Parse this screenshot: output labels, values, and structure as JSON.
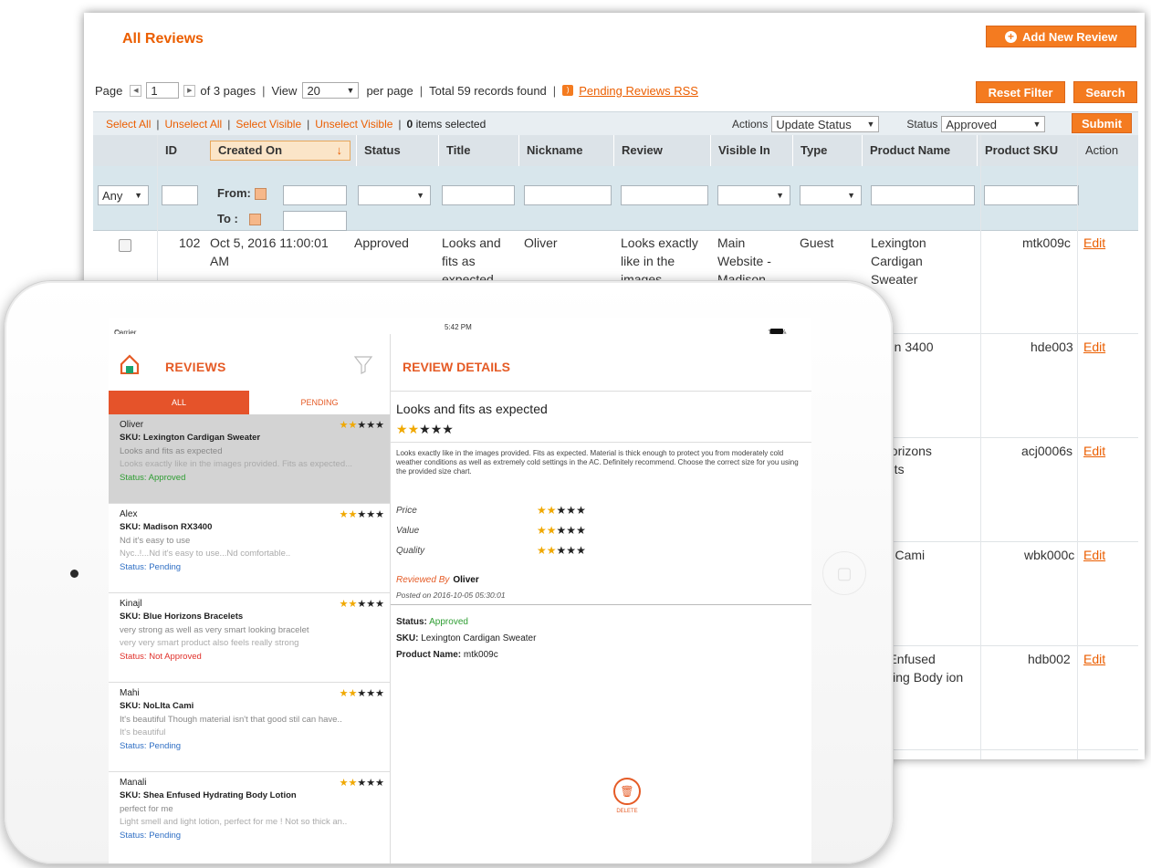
{
  "admin": {
    "title": "All Reviews",
    "add_button": "Add New Review",
    "pager": {
      "page_label": "Page",
      "page_value": "1",
      "of_pages": "of 3 pages",
      "view_label": "View",
      "view_value": "20",
      "per_page": "per page",
      "total": "Total 59 records found",
      "rss_link": "Pending Reviews RSS"
    },
    "reset_filter": "Reset Filter",
    "search": "Search",
    "massaction": {
      "select_all": "Select All",
      "unselect_all": "Unselect All",
      "select_visible": "Select Visible",
      "unselect_visible": "Unselect Visible",
      "items_count": "0",
      "items_selected": "items selected",
      "actions_label": "Actions",
      "actions_value": "Update Status",
      "status_label": "Status",
      "status_value": "Approved",
      "submit": "Submit"
    },
    "columns": [
      "ID",
      "Created On",
      "Status",
      "Title",
      "Nickname",
      "Review",
      "Visible In",
      "Type",
      "Product Name",
      "Product SKU",
      "Action"
    ],
    "filters": {
      "any": "Any",
      "from": "From:",
      "to": "To :"
    },
    "rows": [
      {
        "id": "102",
        "created": "Oct 5, 2016 11:00:01 AM",
        "status": "Approved",
        "title": "Looks and fits as expected",
        "nickname": "Oliver",
        "review": "Looks exactly like in the images",
        "visible": "Main Website - Madison",
        "type": "Guest",
        "product": "Lexington Cardigan Sweater",
        "sku": "mtk009c",
        "action": "Edit"
      },
      {
        "product": "dison 3400",
        "sku": "hde003",
        "action": "Edit"
      },
      {
        "product": "e Horizons celets",
        "sku": "acj0006s",
        "action": "Edit"
      },
      {
        "product": "Llta Cami",
        "sku": "wbk000c",
        "action": "Edit"
      },
      {
        "product": "ea Enfused drating Body ion",
        "sku": "hdb002",
        "action": "Edit"
      }
    ]
  },
  "tablet": {
    "status_carrier": "Carrier",
    "status_time": "5:42 PM",
    "status_battery": "100%",
    "left_title": "REVIEWS",
    "tab_all": "ALL",
    "tab_pending": "PENDING",
    "reviews": [
      {
        "name": "Oliver",
        "stars": 2,
        "sku": "SKU: Lexington Cardigan Sweater",
        "title": "Looks and fits as expected",
        "body": "Looks exactly like in the images provided. Fits as expected...",
        "status": "Status: Approved",
        "status_kind": "approved"
      },
      {
        "name": "Alex",
        "stars": 2,
        "sku": "SKU: Madison RX3400",
        "title": "Nd it's easy to use",
        "body": "Nyc..!...Nd it's easy to use...Nd comfortable..",
        "status": "Status: Pending",
        "status_kind": "pending"
      },
      {
        "name": "Kinajl",
        "stars": 2,
        "sku": "SKU: Blue Horizons Bracelets",
        "title": "very strong as well as very smart looking bracelet",
        "body": "very very smart product also feels really strong",
        "status": "Status: Not Approved",
        "status_kind": "not"
      },
      {
        "name": "Mahi",
        "stars": 2,
        "sku": "SKU: NoLIta Cami",
        "title": "It's beautiful Though material isn't that good stil can have..",
        "body": "It's beautiful",
        "status": "Status: Pending",
        "status_kind": "pending"
      },
      {
        "name": "Manali",
        "stars": 2,
        "sku": "SKU: Shea Enfused Hydrating Body Lotion",
        "title": "perfect for me",
        "body": "Light smell and light lotion, perfect for me ! Not so thick an..",
        "status": "Status: Pending",
        "status_kind": "pending"
      }
    ],
    "detail": {
      "title": "REVIEW DETAILS",
      "heading": "Looks and fits as expected",
      "stars": 2,
      "description": "Looks exactly like in the images provided. Fits as expected. Material is thick enough to protect you from moderately cold weather conditions as well as extremely cold settings in the AC. Definitely recommend. Choose the correct size for you using the provided size chart.",
      "metrics": [
        {
          "label": "Price",
          "stars": 2
        },
        {
          "label": "Value",
          "stars": 2
        },
        {
          "label": "Quality",
          "stars": 2
        }
      ],
      "reviewed_by_label": "Reviewed By",
      "reviewed_by": "Oliver",
      "posted": "Posted on 2016-10-05 05:30:01",
      "status_label": "Status:",
      "status_value": "Approved",
      "sku_label": "SKU:",
      "sku_value": "Lexington Cardigan Sweater",
      "product_label": "Product Name:",
      "product_value": "mtk009c",
      "delete": "DELETE"
    }
  },
  "colors": {
    "accent": "#e55b26",
    "admin_orange": "#f47b20",
    "star": "#f0a800"
  }
}
